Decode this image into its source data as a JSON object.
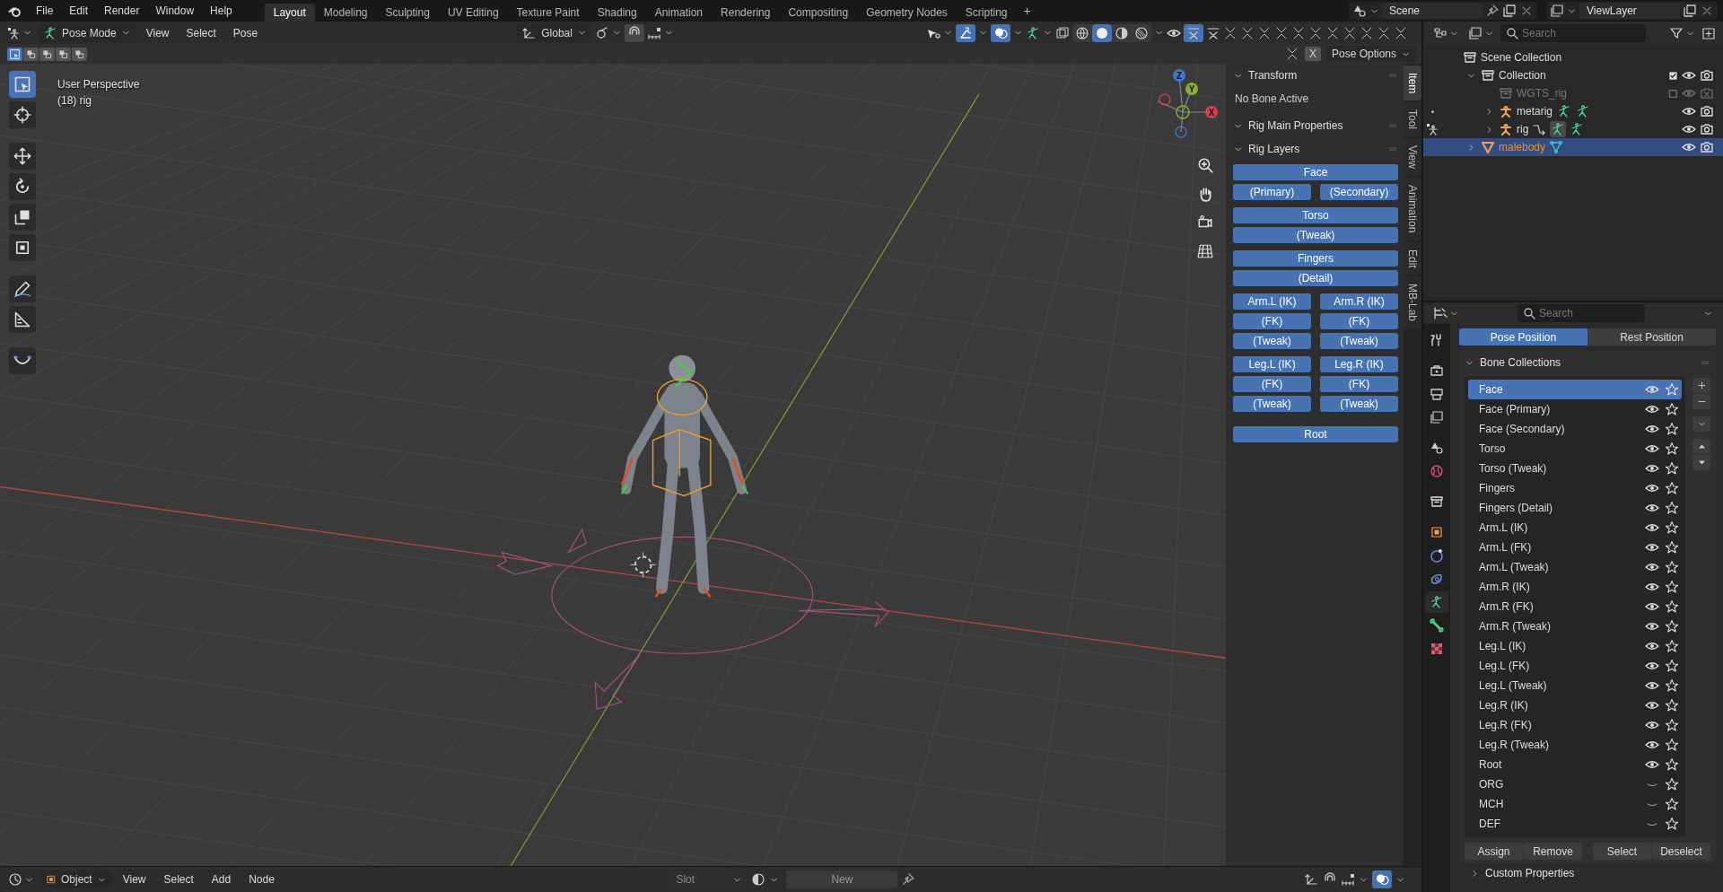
{
  "menu_bar": {
    "menus": [
      "File",
      "Edit",
      "Render",
      "Window",
      "Help"
    ],
    "workspaces": [
      {
        "label": "Layout",
        "selected": true
      },
      {
        "label": "Modeling",
        "selected": false
      },
      {
        "label": "Sculpting",
        "selected": false
      },
      {
        "label": "UV Editing",
        "selected": false
      },
      {
        "label": "Texture Paint",
        "selected": false
      },
      {
        "label": "Shading",
        "selected": false
      },
      {
        "label": "Animation",
        "selected": false
      },
      {
        "label": "Rendering",
        "selected": false
      },
      {
        "label": "Compositing",
        "selected": false
      },
      {
        "label": "Geometry Nodes",
        "selected": false
      },
      {
        "label": "Scripting",
        "selected": false
      }
    ],
    "add_workspace": "+",
    "scene": "Scene",
    "view_layer": "ViewLayer"
  },
  "viewport_header": {
    "mode": "Pose Mode",
    "menus": [
      "View",
      "Select",
      "Pose"
    ],
    "orientation": "Global",
    "shading": [
      {
        "selected": false
      },
      {
        "selected": true
      },
      {
        "selected": false
      },
      {
        "selected": false
      }
    ]
  },
  "tool_settings": {
    "select_modes": [
      {
        "selected": true
      },
      {
        "selected": false
      },
      {
        "selected": false
      },
      {
        "selected": false
      },
      {
        "selected": false
      }
    ],
    "mirror": "X",
    "pose_options": "Pose Options"
  },
  "viewport": {
    "view_name": "User Perspective",
    "object_info": "(18) rig",
    "gizmo_axes": [
      "Z",
      "Y",
      "X"
    ],
    "tools": [
      {
        "selected": true
      },
      {
        "selected": false
      },
      {
        "selected": false
      },
      {
        "selected": false
      },
      {
        "selected": false
      },
      {
        "selected": false
      },
      {
        "selected": false
      },
      {
        "selected": false
      },
      {
        "selected": false
      }
    ]
  },
  "sidebar": {
    "panels": [
      {
        "title": "Transform",
        "expanded": true,
        "note": "No Bone Active"
      },
      {
        "title": "Rig Main Properties",
        "expanded": true
      },
      {
        "title": "Rig Layers",
        "expanded": true
      }
    ],
    "rig_layer_groups": [
      [
        [
          "Face"
        ],
        [
          "(Primary)",
          "(Secondary)"
        ]
      ],
      [
        [
          "Torso"
        ],
        [
          "(Tweak)"
        ]
      ],
      [
        [
          "Fingers"
        ],
        [
          "(Detail)"
        ]
      ],
      [
        [
          "Arm.L (IK)",
          "Arm.R (IK)"
        ],
        [
          "(FK)",
          "(FK)"
        ],
        [
          "(Tweak)",
          "(Tweak)"
        ]
      ],
      [
        [
          "Leg.L (IK)",
          "Leg.R (IK)"
        ],
        [
          "(FK)",
          "(FK)"
        ],
        [
          "(Tweak)",
          "(Tweak)"
        ]
      ],
      [
        [
          "Root"
        ]
      ]
    ],
    "tabs": [
      {
        "label": "Item",
        "selected": true
      },
      {
        "label": "Tool",
        "selected": false
      },
      {
        "label": "View",
        "selected": false
      },
      {
        "label": "Animation",
        "selected": false
      },
      {
        "label": "Edit",
        "selected": false
      },
      {
        "label": "MB-Lab",
        "selected": false
      }
    ]
  },
  "outliner": {
    "search_placeholder": "Search",
    "tree": [
      {
        "name": "Scene Collection",
        "kind": "scene_collection",
        "selected": false,
        "children": [
          {
            "name": "Collection",
            "kind": "collection",
            "selected": false,
            "expanded": true,
            "checked": true,
            "disabled": false,
            "children": [
              {
                "name": "WGTS_rig",
                "kind": "collection",
                "selected": false,
                "checked": false,
                "disabled": true
              },
              {
                "name": "metarig",
                "kind": "armature",
                "selected": false,
                "expanded": false,
                "disabled": false
              },
              {
                "name": "rig",
                "kind": "armature",
                "selected": false,
                "expanded": false,
                "disabled": false
              }
            ]
          },
          {
            "name": "malebody",
            "kind": "mesh",
            "selected": true,
            "expanded": false,
            "disabled": false
          }
        ]
      }
    ]
  },
  "properties": {
    "search_placeholder": "Search",
    "tabs": [
      {
        "selected": false
      },
      {
        "selected": false
      },
      {
        "selected": false
      },
      {
        "selected": false
      },
      {
        "selected": false
      },
      {
        "selected": false
      },
      {
        "selected": false
      },
      {
        "selected": false
      },
      {
        "selected": false
      },
      {
        "selected": false
      },
      {
        "selected": true
      },
      {
        "selected": false
      },
      {
        "selected": false
      }
    ],
    "position": [
      {
        "label": "Pose Position",
        "selected": true
      },
      {
        "label": "Rest Position",
        "selected": false
      }
    ],
    "section": {
      "title": "Bone Collections",
      "expanded": true
    },
    "collections": [
      {
        "name": "Face",
        "selected": true,
        "visible": true
      },
      {
        "name": "Face (Primary)",
        "selected": false,
        "visible": true
      },
      {
        "name": "Face (Secondary)",
        "selected": false,
        "visible": true
      },
      {
        "name": "Torso",
        "selected": false,
        "visible": true
      },
      {
        "name": "Torso (Tweak)",
        "selected": false,
        "visible": true
      },
      {
        "name": "Fingers",
        "selected": false,
        "visible": true
      },
      {
        "name": "Fingers (Detail)",
        "selected": false,
        "visible": true
      },
      {
        "name": "Arm.L (IK)",
        "selected": false,
        "visible": true
      },
      {
        "name": "Arm.L (FK)",
        "selected": false,
        "visible": true
      },
      {
        "name": "Arm.L (Tweak)",
        "selected": false,
        "visible": true
      },
      {
        "name": "Arm.R (IK)",
        "selected": false,
        "visible": true
      },
      {
        "name": "Arm.R (FK)",
        "selected": false,
        "visible": true
      },
      {
        "name": "Arm.R (Tweak)",
        "selected": false,
        "visible": true
      },
      {
        "name": "Leg.L (IK)",
        "selected": false,
        "visible": true
      },
      {
        "name": "Leg.L (FK)",
        "selected": false,
        "visible": true
      },
      {
        "name": "Leg.L (Tweak)",
        "selected": false,
        "visible": true
      },
      {
        "name": "Leg.R (IK)",
        "selected": false,
        "visible": true
      },
      {
        "name": "Leg.R (FK)",
        "selected": false,
        "visible": true
      },
      {
        "name": "Leg.R (Tweak)",
        "selected": false,
        "visible": true
      },
      {
        "name": "Root",
        "selected": false,
        "visible": true
      },
      {
        "name": "ORG",
        "selected": false,
        "visible": false
      },
      {
        "name": "MCH",
        "selected": false,
        "visible": false
      },
      {
        "name": "DEF",
        "selected": false,
        "visible": false
      }
    ],
    "actions": [
      "Assign",
      "Remove",
      "Select",
      "Deselect"
    ],
    "next_section": "Custom Properties"
  },
  "bottom_bar": {
    "editor": "Object",
    "menus": [
      "View",
      "Select",
      "Add",
      "Node"
    ],
    "slot": "Slot",
    "new": "New"
  }
}
